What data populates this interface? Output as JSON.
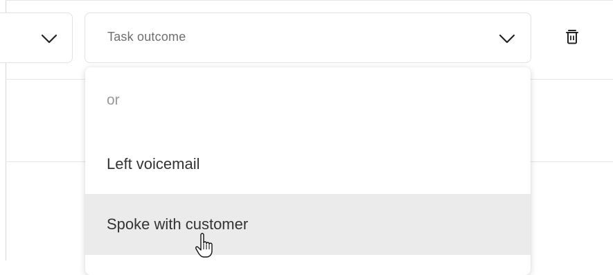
{
  "task_outcome_select": {
    "placeholder": "Task outcome",
    "chevron_icon": "chevron-down-icon"
  },
  "left_select": {
    "chevron_icon": "chevron-down-icon"
  },
  "delete_icon": "trash-icon",
  "dropdown": {
    "options": [
      {
        "label": "or",
        "kind": "separator-text"
      },
      {
        "label": "Left voicemail",
        "kind": "option"
      },
      {
        "label": "Spoke with customer",
        "kind": "option",
        "hovered": true
      }
    ]
  },
  "pointer": "hand-pointer-cursor",
  "colors": {
    "border": "#e1e1e1",
    "hover_bg": "#ebebeb",
    "placeholder": "#6f6f6f",
    "muted": "#9a9a9a",
    "text": "#333333"
  }
}
